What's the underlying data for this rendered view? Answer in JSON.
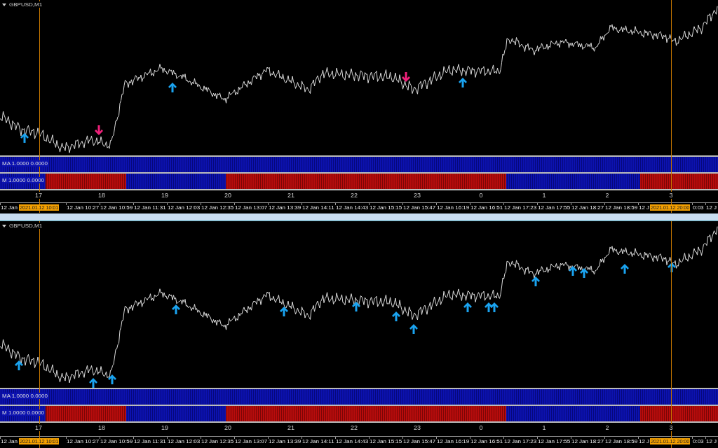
{
  "panels": [
    {
      "symbol": "GBPUSD,M1",
      "indicators": [
        {
          "label": "MA 1.0000 0.0000"
        },
        {
          "label": "M 1.0000 0.0000"
        }
      ],
      "hour_labels": [
        "17",
        "18",
        "19",
        "20",
        "21",
        "22",
        "23",
        "0",
        "1",
        "2",
        "3"
      ],
      "time_labels": [
        "12 Jan",
        "12 Jan 10:27",
        "12 Jan 10:59",
        "12 Jan 11:31",
        "12 Jan 12:03",
        "12 Jan 12:35",
        "12 Jan 13:07",
        "12 Jan 13:39",
        "12 Jan 14:11",
        "12 Jan 14:43",
        "12 Jan 15:15",
        "12 Jan 15:47",
        "12 Jan 16:19",
        "12 Jan 16:51",
        "12 Jan 17:23",
        "12 Jan 17:55",
        "12 Jan 18:27",
        "12 Jan 18:59",
        "12 J",
        "0:03",
        "12 J"
      ],
      "cursor_labels": [
        "2021.01.12 10:01",
        "2021.01.12 20:00"
      ]
    },
    {
      "symbol": "GBPUSD,M1",
      "indicators": [
        {
          "label": "MA 1.0000 0.0000"
        },
        {
          "label": "M 1.0000 0.0000"
        }
      ],
      "hour_labels": [
        "17",
        "18",
        "19",
        "20",
        "21",
        "22",
        "23",
        "0",
        "1",
        "2",
        "3"
      ],
      "time_labels": [
        "12 Jan",
        "12 Jan 10:27",
        "12 Jan 10:59",
        "12 Jan 11:31",
        "12 Jan 12:03",
        "12 Jan 12:35",
        "12 Jan 13:07",
        "12 Jan 13:39",
        "12 Jan 14:11",
        "12 Jan 14:43",
        "12 Jan 15:15",
        "12 Jan 15:47",
        "12 Jan 16:19",
        "12 Jan 16:51",
        "12 Jan 17:23",
        "12 Jan 17:55",
        "12 Jan 18:27",
        "12 Jan 18:59",
        "12 J",
        "0:03",
        "12 J"
      ],
      "cursor_labels": [
        "2021.01.12 10:01",
        "2021.01.12 20:00"
      ]
    }
  ]
}
